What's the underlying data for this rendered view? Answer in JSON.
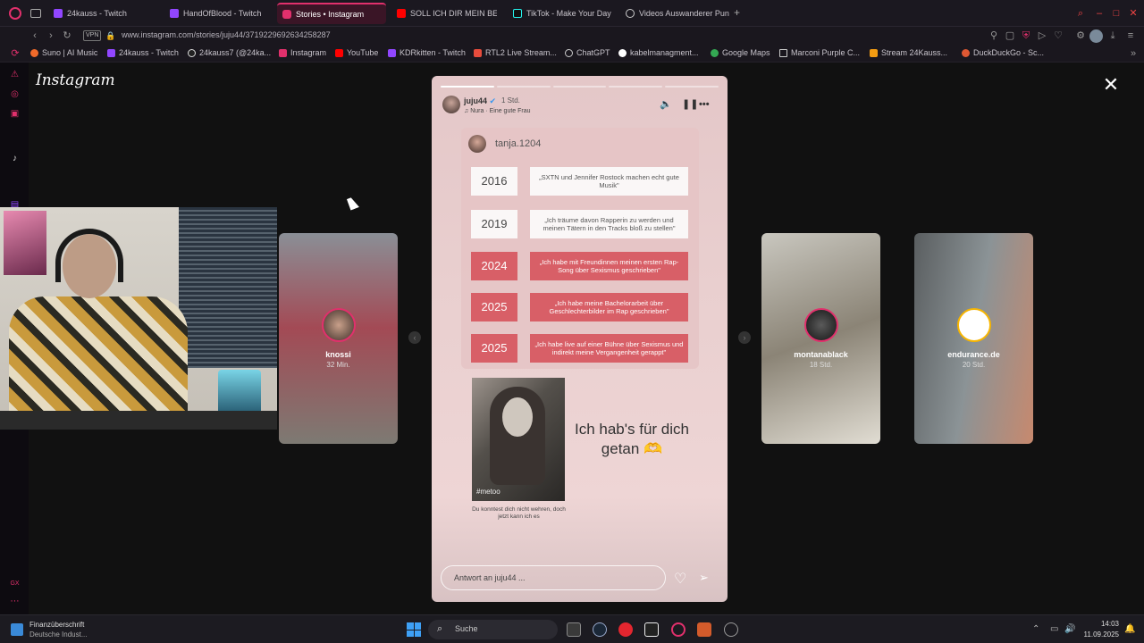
{
  "tabs": [
    {
      "label": "24kauss - Twitch",
      "color": "#9146ff"
    },
    {
      "label": "HandOfBlood - Twitch",
      "color": "#9146ff"
    },
    {
      "label": "Stories • Instagram",
      "color": "#e1306c"
    },
    {
      "label": "SOLL ICH DIR MEIN BETT",
      "color": "#ff0000"
    },
    {
      "label": "TikTok - Make Your Day",
      "color": "#25f4ee"
    },
    {
      "label": "Videos Auswanderer Pun",
      "color": "#cccccc"
    }
  ],
  "address": {
    "url": "www.instagram.com/stories/juju44/3719229692634258287",
    "vpn_label": "VPN"
  },
  "bookmarks": [
    {
      "label": "Suno | AI Music",
      "color": "#f06a2a"
    },
    {
      "label": "24kauss - Twitch",
      "color": "#9146ff"
    },
    {
      "label": "24kauss7 (@24ka...",
      "color": "#dddddd"
    },
    {
      "label": "Instagram",
      "color": "#e1306c"
    },
    {
      "label": "YouTube",
      "color": "#ff0000"
    },
    {
      "label": "KDRkitten - Twitch",
      "color": "#9146ff"
    },
    {
      "label": "RTL2 Live Stream...",
      "color": "#e74c3c"
    },
    {
      "label": "ChatGPT",
      "color": "#cccccc"
    },
    {
      "label": "kabelmanagment...",
      "color": "#dddddd"
    },
    {
      "label": "Google Maps",
      "color": "#34a853"
    },
    {
      "label": "Marconi Purple C...",
      "color": "#cccccc"
    },
    {
      "label": "Stream 24Kauss...",
      "color": "#f39c12"
    },
    {
      "label": "DuckDuckGo - Sc...",
      "color": "#de5833"
    }
  ],
  "instagram": {
    "logo": "Instagram",
    "close_icon": "close-icon"
  },
  "side_stories": [
    {
      "name": "knossi",
      "time": "32 Min."
    },
    {
      "name": "montanablack",
      "time": "18 Std."
    },
    {
      "name": "endurance.de",
      "time": "20 Std."
    }
  ],
  "story": {
    "username": "juju44",
    "time": "1 Std.",
    "music": "Nura · Eine gute Frau",
    "card_user": "tanja.1204",
    "timeline": [
      {
        "year": "2016",
        "text": "„SXTN und Jennifer Rostock machen echt gute Musik\"",
        "style": "light"
      },
      {
        "year": "2019",
        "text": "„Ich träume davon Rapperin zu werden und meinen Tätern in den Tracks bloß zu stellen\"",
        "style": "light"
      },
      {
        "year": "2024",
        "text": "„Ich habe mit Freundinnen meinen ersten Rap-Song über Sexismus geschrieben\"",
        "style": "red"
      },
      {
        "year": "2025",
        "text": "„Ich habe meine Bachelorarbeit über Geschlechterbilder im Rap geschrieben\"",
        "style": "red"
      },
      {
        "year": "2025",
        "text": "„Ich habe live auf einer Bühne über Sexismus und indirekt meine Vergangenheit gerappt\"",
        "style": "red"
      }
    ],
    "photo_tag": "#metoo",
    "photo_caption": "Du konntest dich nicht wehren, doch jetzt kann ich es",
    "headline": "Ich hab's für dich getan 🫶",
    "reply_placeholder": "Antwort an juju44 ..."
  },
  "taskbar": {
    "news_title": "Finanzüberschrift",
    "news_sub": "Deutsche Indust...",
    "search_label": "Suche",
    "time": "14:03",
    "date": "11.09.2025"
  }
}
